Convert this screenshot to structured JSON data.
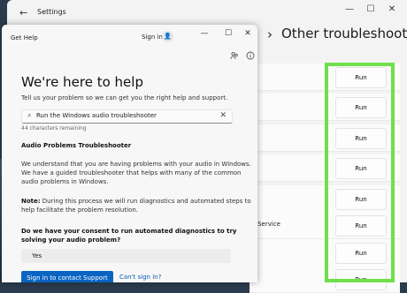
{
  "settings": {
    "app_title": "Settings",
    "back_glyph": "←",
    "controls": {
      "minimize": "—",
      "maximize": "☐",
      "close": "✕"
    },
    "breadcrumb_sep": "›",
    "page_title": "Other troubleshooters",
    "rows": [
      {
        "name": "",
        "button": "Run"
      },
      {
        "name": "",
        "button": "Run"
      },
      {
        "name": "",
        "button": "Run"
      },
      {
        "name": "",
        "button": "Run"
      },
      {
        "name": "",
        "button": "Run"
      },
      {
        "name": "r Service",
        "button": "Run"
      },
      {
        "name": "",
        "button": "Run"
      },
      {
        "name": "",
        "button": "Run"
      }
    ],
    "highlight_color": "#6fe04b"
  },
  "get_help": {
    "title": "Get Help",
    "sign_in": "Sign in",
    "avatar_glyph": "👤",
    "controls": {
      "minimize": "—",
      "maximize": "☐",
      "close": "✕"
    },
    "heading": "We're here to help",
    "subheading": "Tell us your problem so we can get you the right help and support.",
    "search": {
      "glyph": "⌕",
      "value": "Run the Windows audio troubleshooter",
      "clear_glyph": "✕"
    },
    "char_count": "44 characters remaining",
    "section_title": "Audio Problems Troubleshooter",
    "paragraph1": "We understand that you are having problems with your audio in Windows. We have a guided troubleshooter that helps with many of the common audio problems in Windows.",
    "note_label": "Note:",
    "note_text": " During this process we will run diagnostics and automated steps to help facilitate the problem resolution.",
    "question": "Do we have your consent to run automated diagnostics to try solving your audio problem?",
    "yes_option": "Yes",
    "contact_button": "Sign in to contact Support",
    "cant_sign_in": "Can't sign in?",
    "accent_color": "#0a64c2"
  }
}
